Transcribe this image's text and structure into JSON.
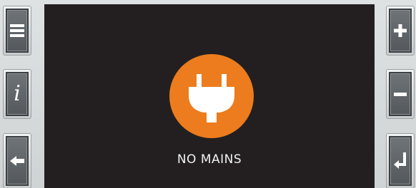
{
  "screen": {
    "status_text": "NO MAINS",
    "alarm_icon": "unplugged-mains-icon",
    "alarm_color": "#ec7c1d",
    "background_color": "#231f20"
  },
  "left_buttons": [
    {
      "name": "menu",
      "icon": "menu-icon"
    },
    {
      "name": "info",
      "icon": "info-icon",
      "glyph": "i"
    },
    {
      "name": "back",
      "icon": "back-arrow-icon"
    }
  ],
  "right_buttons": [
    {
      "name": "plus",
      "icon": "plus-icon"
    },
    {
      "name": "minus",
      "icon": "minus-icon"
    },
    {
      "name": "enter",
      "icon": "enter-icon"
    }
  ]
}
